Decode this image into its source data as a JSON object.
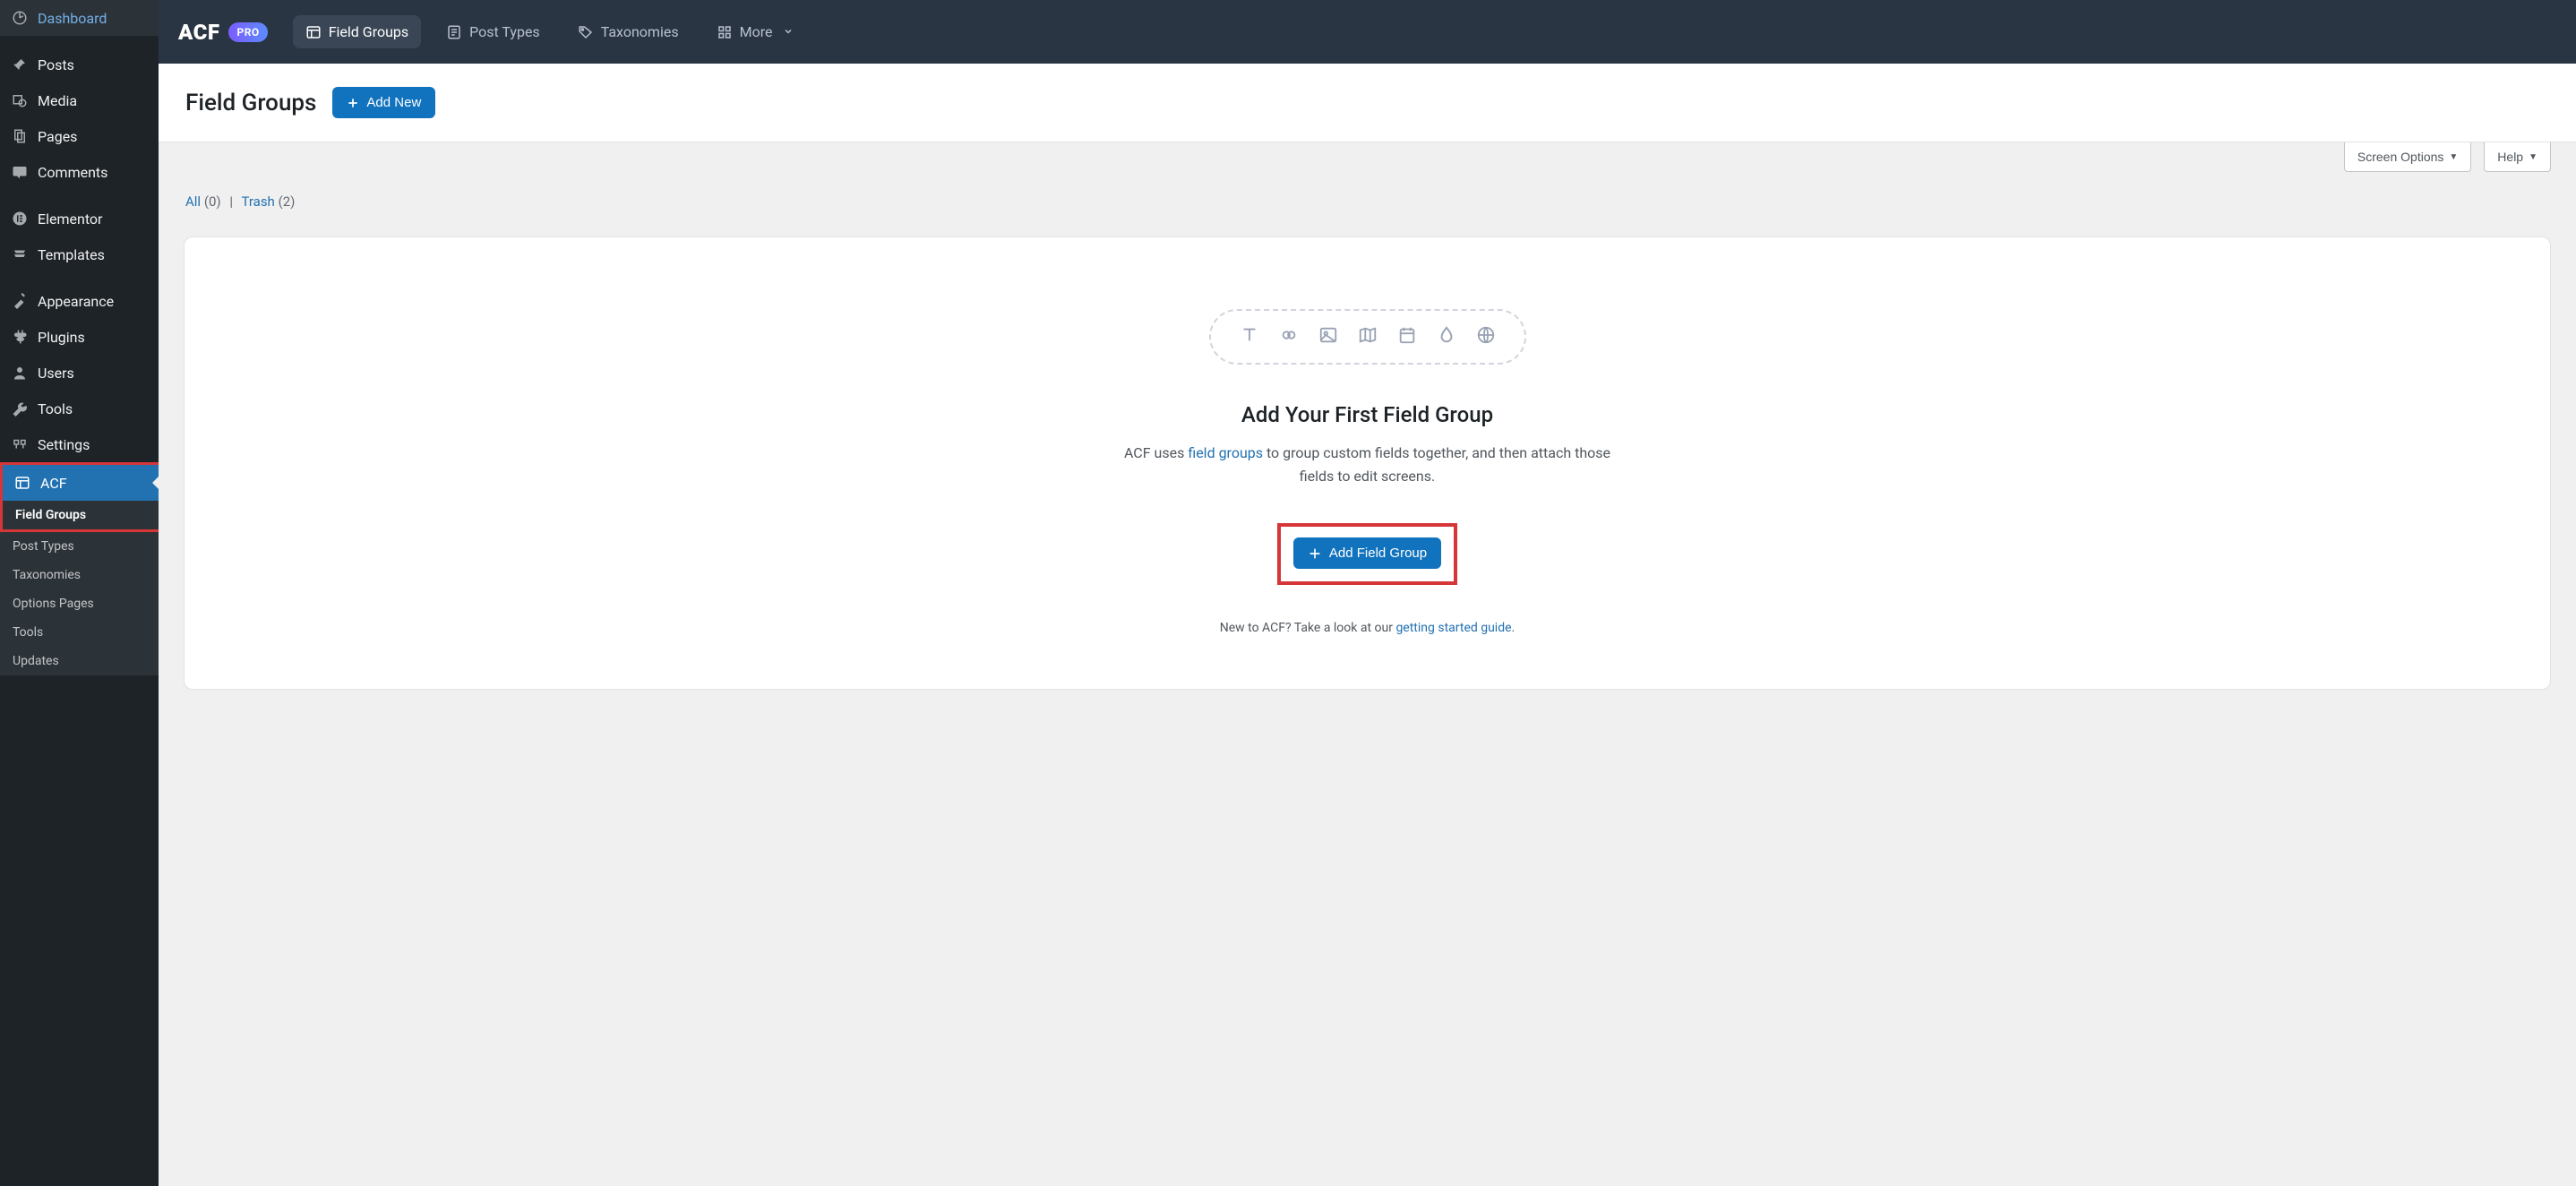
{
  "sidebar": {
    "items": [
      {
        "label": "Dashboard",
        "icon": "dashboard-icon"
      },
      {
        "label": "Posts",
        "icon": "pin-icon"
      },
      {
        "label": "Media",
        "icon": "media-icon"
      },
      {
        "label": "Pages",
        "icon": "pages-icon"
      },
      {
        "label": "Comments",
        "icon": "comments-icon"
      },
      {
        "label": "Elementor",
        "icon": "elementor-icon"
      },
      {
        "label": "Templates",
        "icon": "templates-icon"
      },
      {
        "label": "Appearance",
        "icon": "appearance-icon"
      },
      {
        "label": "Plugins",
        "icon": "plugins-icon"
      },
      {
        "label": "Users",
        "icon": "users-icon"
      },
      {
        "label": "Tools",
        "icon": "tools-icon"
      },
      {
        "label": "Settings",
        "icon": "settings-icon"
      },
      {
        "label": "ACF",
        "icon": "acf-layout-icon"
      }
    ],
    "submenu": [
      {
        "label": "Field Groups",
        "current": true
      },
      {
        "label": "Post Types"
      },
      {
        "label": "Taxonomies"
      },
      {
        "label": "Options Pages"
      },
      {
        "label": "Tools"
      },
      {
        "label": "Updates"
      }
    ]
  },
  "topbar": {
    "logo": "ACF",
    "pro_badge": "PRO",
    "tabs": [
      {
        "label": "Field Groups",
        "icon": "layout-icon",
        "active": true
      },
      {
        "label": "Post Types",
        "icon": "post-type-icon"
      },
      {
        "label": "Taxonomies",
        "icon": "tag-icon"
      },
      {
        "label": "More",
        "icon": "grid-icon",
        "chevron": true
      }
    ]
  },
  "page": {
    "title": "Field Groups",
    "add_new": "Add New",
    "screen_options": "Screen Options",
    "help": "Help"
  },
  "filters": {
    "all_label": "All",
    "all_count": "(0)",
    "trash_label": "Trash",
    "trash_count": "(2)"
  },
  "empty": {
    "title": "Add Your First Field Group",
    "desc_prefix": "ACF uses ",
    "desc_link": "field groups",
    "desc_suffix": " to group custom fields together, and then attach those fields to edit screens.",
    "button": "Add Field Group",
    "footer_prefix": "New to ACF? Take a look at our ",
    "footer_link": "getting started guide",
    "footer_suffix": "."
  }
}
